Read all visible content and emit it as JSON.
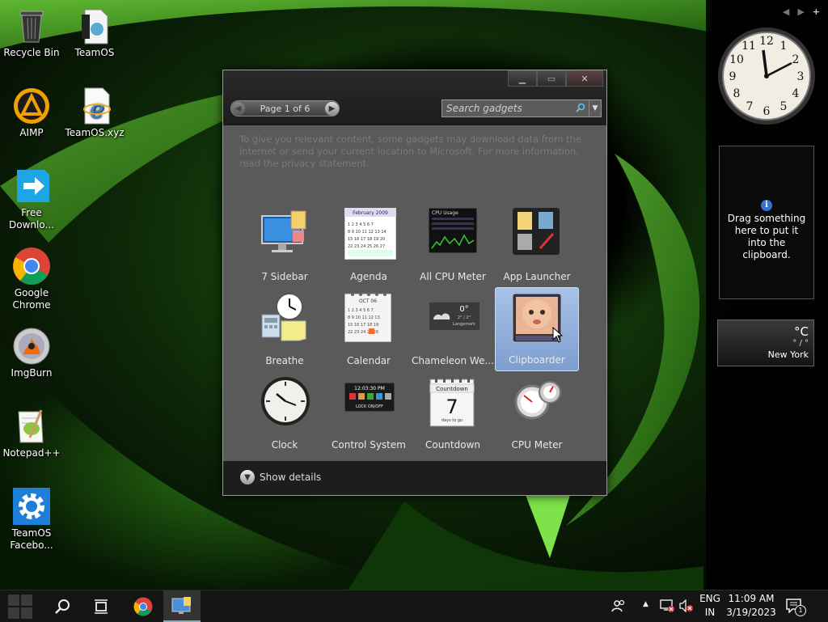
{
  "desktop": {
    "icons": [
      {
        "label": "Recycle Bin",
        "icon": "recycle-bin-icon"
      },
      {
        "label": "TeamOS",
        "icon": "file-icon"
      },
      {
        "label": "AIMP",
        "icon": "aimp-icon"
      },
      {
        "label": "TeamOS.xyz",
        "icon": "internet-explorer-icon"
      },
      {
        "label": "Free Downlo...",
        "icon": "free-download-manager-icon"
      },
      {
        "label": "Google Chrome",
        "icon": "chrome-icon"
      },
      {
        "label": "ImgBurn",
        "icon": "imgburn-icon"
      },
      {
        "label": "Notepad++",
        "icon": "notepad-plus-plus-icon"
      },
      {
        "label": "TeamOS Facebo...",
        "icon": "gear-icon"
      }
    ]
  },
  "gallery": {
    "page_label": "Page 1 of 6",
    "search_placeholder": "Search gadgets",
    "notice": "To give you relevant content, some gadgets may download data from the Internet or send your current location to Microsoft. For more information, read the privacy statement.",
    "gadgets": [
      {
        "name": "7 Sidebar",
        "icon": "sidebar-gadget-icon",
        "selected": false
      },
      {
        "name": "Agenda",
        "icon": "agenda-gadget-icon",
        "selected": false
      },
      {
        "name": "All CPU Meter",
        "icon": "cpu-graph-gadget-icon",
        "selected": false
      },
      {
        "name": "App Launcher",
        "icon": "app-launcher-gadget-icon",
        "selected": false
      },
      {
        "name": "Breathe",
        "icon": "breathe-gadget-icon",
        "selected": false
      },
      {
        "name": "Calendar",
        "icon": "calendar-gadget-icon",
        "selected": false
      },
      {
        "name": "Chameleon We...",
        "icon": "weather-gadget-icon",
        "selected": false
      },
      {
        "name": "Clipboarder",
        "icon": "clipboarder-gadget-icon",
        "selected": true
      },
      {
        "name": "Clock",
        "icon": "clock-gadget-icon",
        "selected": false
      },
      {
        "name": "Control System",
        "icon": "control-system-gadget-icon",
        "selected": false
      },
      {
        "name": "Countdown",
        "icon": "countdown-gadget-icon",
        "selected": false
      },
      {
        "name": "CPU Meter",
        "icon": "cpu-meter-gadget-icon",
        "selected": false
      }
    ],
    "art": {
      "agenda_month": "February 2009",
      "calendar_month": "OCT 06",
      "weather_temp": "0°",
      "weather_range": "2° / 2°",
      "weather_city": "Langemark",
      "control_time": "12:03:30 PM",
      "control_lock": "LOCK ON/OFF",
      "countdown_title": "Countdown",
      "countdown_number": "7",
      "countdown_sub": "days to go",
      "cpu_title": "CPU Usage"
    },
    "show_details": "Show details"
  },
  "sidebar": {
    "clipboard_text": "Drag something here to put it into the clipboard.",
    "weather_unit": "°C",
    "weather_range": "° / °",
    "weather_city": "New York"
  },
  "tray": {
    "lang_top": "ENG",
    "lang_bottom": "IN",
    "time": "11:09 AM",
    "date": "3/19/2023",
    "notifications": "1"
  },
  "colors": {
    "accent_selected": "#8fb0dc",
    "taskbar": "#151515",
    "wallpaper_green": "#3fa01a"
  }
}
